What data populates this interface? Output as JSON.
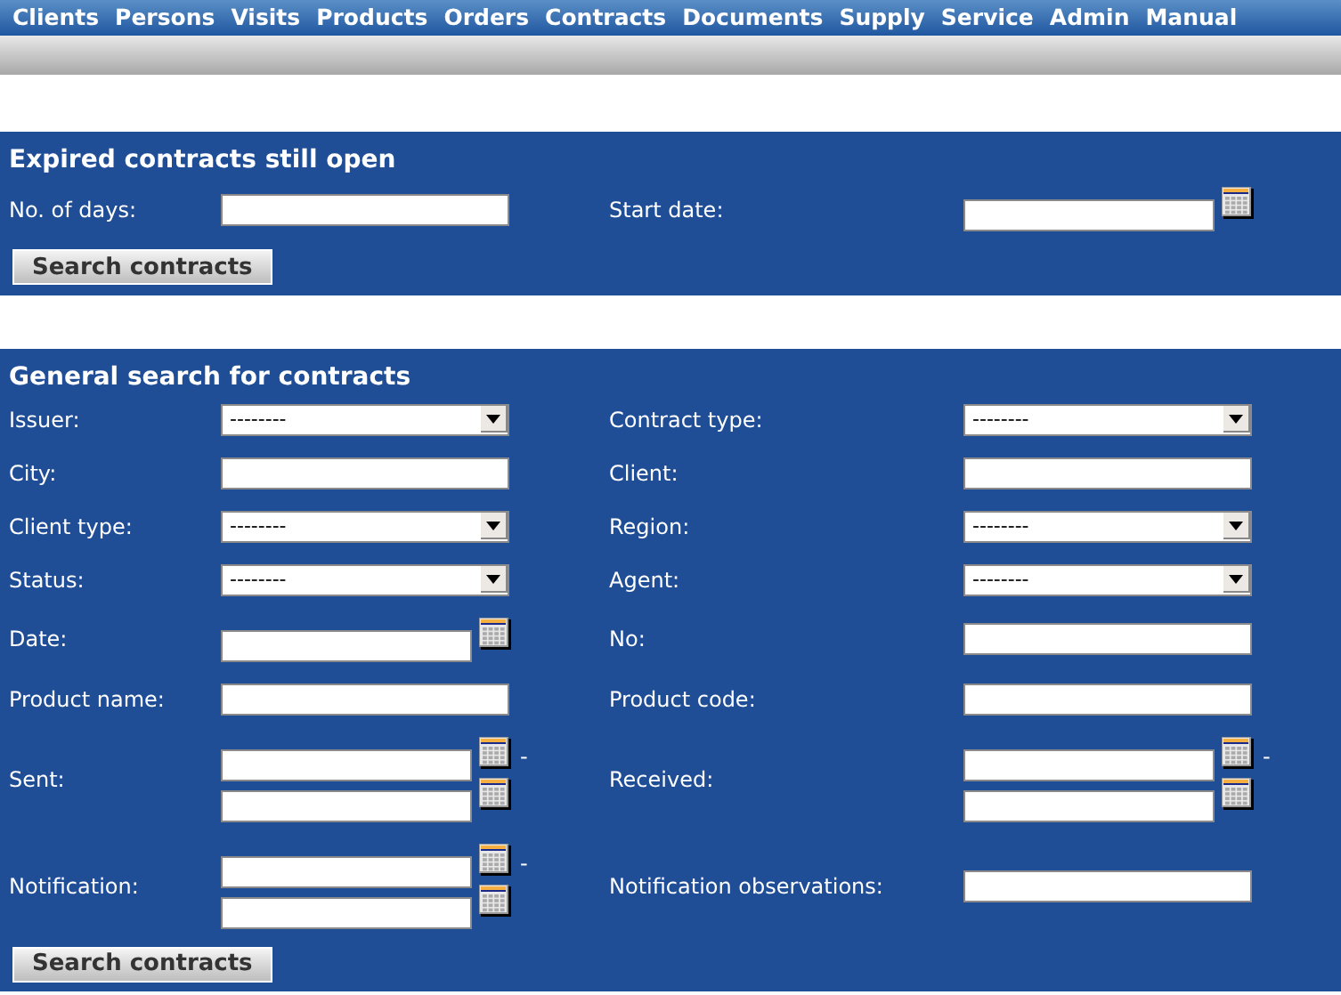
{
  "menu": [
    {
      "label": "Clients"
    },
    {
      "label": "Persons"
    },
    {
      "label": "Visits"
    },
    {
      "label": "Products"
    },
    {
      "label": "Orders"
    },
    {
      "label": "Contracts"
    },
    {
      "label": "Documents"
    },
    {
      "label": "Supply"
    },
    {
      "label": "Service"
    },
    {
      "label": "Admin"
    },
    {
      "label": "Manual"
    }
  ],
  "sections": [
    {
      "title": "Expired contracts still open",
      "rows": [
        {
          "left": {
            "label": "No. of days:",
            "kind": "text"
          },
          "right": {
            "label": "Start date:",
            "kind": "date"
          }
        }
      ],
      "button": "Search contracts"
    },
    {
      "title": "General search for contracts",
      "rows": [
        {
          "left": {
            "label": "Issuer:",
            "kind": "select",
            "value": "--------"
          },
          "right": {
            "label": "Contract type:",
            "kind": "select",
            "value": "--------"
          }
        },
        {
          "left": {
            "label": "City:",
            "kind": "text"
          },
          "right": {
            "label": "Client:",
            "kind": "text"
          }
        },
        {
          "left": {
            "label": "Client type:",
            "kind": "select",
            "value": "--------"
          },
          "right": {
            "label": "Region:",
            "kind": "select",
            "value": "--------"
          }
        },
        {
          "left": {
            "label": "Status:",
            "kind": "select",
            "value": "--------"
          },
          "right": {
            "label": "Agent:",
            "kind": "select",
            "value": "--------"
          }
        },
        {
          "left": {
            "label": "Date:",
            "kind": "date"
          },
          "right": {
            "label": "No:",
            "kind": "text"
          }
        },
        {
          "left": {
            "label": "Product name:",
            "kind": "text"
          },
          "right": {
            "label": "Product code:",
            "kind": "text"
          }
        },
        {
          "left": {
            "label": "Sent:",
            "kind": "range",
            "separator": "-"
          },
          "right": {
            "label": "Received:",
            "kind": "range",
            "separator": "-"
          }
        },
        {
          "left": {
            "label": "Notification:",
            "kind": "range",
            "separator": "-"
          },
          "right": {
            "label": "Notification observations:",
            "kind": "text"
          }
        }
      ],
      "button": "Search contracts"
    }
  ]
}
